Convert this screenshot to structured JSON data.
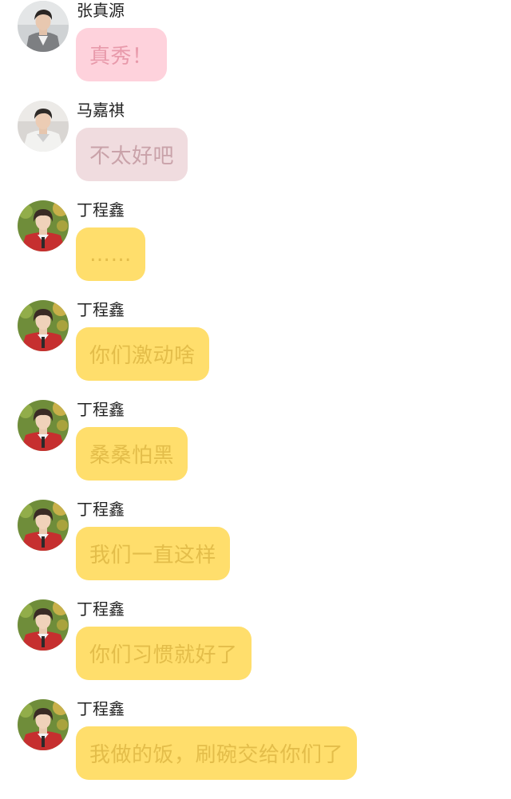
{
  "messages": [
    {
      "sender": "张真源",
      "text": "真秀！",
      "bubble_color": "#fed2dc",
      "text_color": "#e89aab",
      "avatar": "avatar-zhang-zhenyuan"
    },
    {
      "sender": "马嘉祺",
      "text": "不太好吧",
      "bubble_color": "#f0dcdf",
      "text_color": "#c9a2a9",
      "avatar": "avatar-ma-jiaqi"
    },
    {
      "sender": "丁程鑫",
      "text": "……",
      "bubble_color": "#ffde6c",
      "text_color": "#e3bd4a",
      "avatar": "avatar-ding-chengxin"
    },
    {
      "sender": "丁程鑫",
      "text": "你们激动啥",
      "bubble_color": "#ffde6c",
      "text_color": "#e3bd4a",
      "avatar": "avatar-ding-chengxin"
    },
    {
      "sender": "丁程鑫",
      "text": "桑桑怕黑",
      "bubble_color": "#ffde6c",
      "text_color": "#e3bd4a",
      "avatar": "avatar-ding-chengxin"
    },
    {
      "sender": "丁程鑫",
      "text": "我们一直这样",
      "bubble_color": "#ffde6c",
      "text_color": "#e3bd4a",
      "avatar": "avatar-ding-chengxin"
    },
    {
      "sender": "丁程鑫",
      "text": "你们习惯就好了",
      "bubble_color": "#ffde6c",
      "text_color": "#e3bd4a",
      "avatar": "avatar-ding-chengxin"
    },
    {
      "sender": "丁程鑫",
      "text": "我做的饭，刷碗交给你们了",
      "bubble_color": "#ffde6c",
      "text_color": "#e3bd4a",
      "avatar": "avatar-ding-chengxin"
    }
  ]
}
